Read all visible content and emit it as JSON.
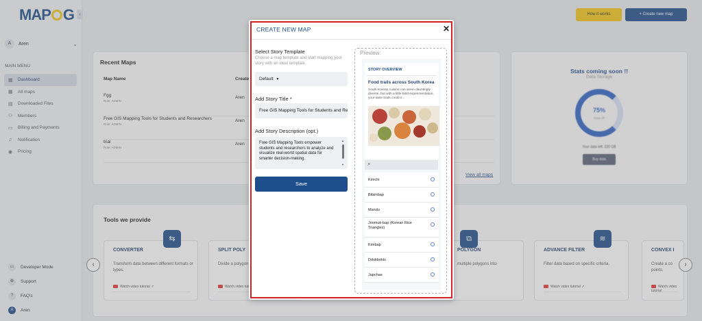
{
  "app": {
    "logo_text": "MAPOG",
    "logo_left": "MAP",
    "logo_right": "G",
    "collapse_icon": "‹"
  },
  "header": {
    "how_it_works": "How it works",
    "create_new_map": "+ Create new map"
  },
  "sidebar": {
    "user": {
      "initial": "A",
      "name": "Aren",
      "chevron": "⌄"
    },
    "menu_heading": "MAIN MENU",
    "items": [
      {
        "label": "Dashboard",
        "icon": "▦",
        "active": true
      },
      {
        "label": "All maps",
        "icon": "▦"
      },
      {
        "label": "Downloaded Files",
        "icon": "▤"
      },
      {
        "label": "Members",
        "icon": "⚇"
      },
      {
        "label": "Billing and Payments",
        "icon": "▭"
      },
      {
        "label": "Notification",
        "icon": "♫"
      },
      {
        "label": "Pricing",
        "icon": "◉"
      }
    ],
    "bottom": [
      {
        "label": "Developer Mode",
        "icon": "▭"
      },
      {
        "label": "Support",
        "icon": "⚙"
      },
      {
        "label": "FAQ's",
        "icon": "?"
      },
      {
        "label": "Aren",
        "icon": "A"
      }
    ]
  },
  "recent_maps": {
    "title": "Recent Maps",
    "col_name": "Map Name",
    "col_created": "Create",
    "rows": [
      {
        "name": "Fgg",
        "role": "Role: ADMIN",
        "creator": "Aren"
      },
      {
        "name": "Free GIS Mapping Tools for Students and Researchers",
        "role": "Role: ADMIN",
        "creator": "Aren"
      },
      {
        "name": "trial",
        "role": "Role: ADMIN",
        "creator": "Aren"
      }
    ],
    "view_all": "View all maps"
  },
  "stats": {
    "title": "Stats coming soon !!",
    "subtitle": "Data Storage",
    "percent": "75%",
    "ring_label": "Data off",
    "footer": "Your data left: 220 GB",
    "button": "Buy data"
  },
  "tools": {
    "title": "Tools we provide",
    "watch_label": "Watch video tutorial",
    "cards": [
      {
        "title": "CONVERTER",
        "desc": "Transform data between different formats or types.",
        "icon": "⇆"
      },
      {
        "title": "SPLIT POLY",
        "desc": "Divide a polygon into sections.",
        "icon": "◧"
      },
      {
        "title": "POLYGON",
        "desc": "multiple polygons into",
        "icon": "⧉"
      },
      {
        "title": "ADVANCE FILTER",
        "desc": "Filter data based on specific criteria.",
        "icon": "≋"
      },
      {
        "title": "CONVEX I",
        "desc": "Create a co points.",
        "icon": "◇"
      }
    ],
    "prev_icon": "‹",
    "next_icon": "›"
  },
  "modal": {
    "title": "CREATE NEW MAP",
    "close_icon": "✕",
    "template_label": "Select Story Template",
    "template_hint": "Choose a map template and start mapping your story with an ideal template.",
    "template_value": "Default",
    "dropdown_icon": "▾",
    "title_label": "Add Story Title *",
    "title_value": "Free GIS Mapping Tools for Students and Researchers",
    "desc_label": "Add Story Description (opt.)",
    "desc_value": "Free GIS Mapping Tools empower students and researchers to analyze and visualize real-world spatial data for smarter decision-making.",
    "save_label": "Save",
    "scroll_up": "▲",
    "scroll_down": "▼"
  },
  "preview": {
    "heading": "Preview:",
    "overview": "STORY OVERVIEW",
    "story_title": "Food trails across South Korea",
    "story_desc": "South Korean cuisine can seem dauntingly diverse, but with a little bold experimentation, your taste buds could s...",
    "search_icon": "⌕",
    "items": [
      "Kimchi",
      "Bibimbap",
      "Mandu",
      "Joomuk-bap (Korean Rice Triangles)",
      "Kimbap",
      "Ddukbokki",
      "Japchae"
    ]
  },
  "colors": {
    "brand": "#1f4e8c",
    "accent": "#f0c419",
    "highlight": "#d32027"
  }
}
